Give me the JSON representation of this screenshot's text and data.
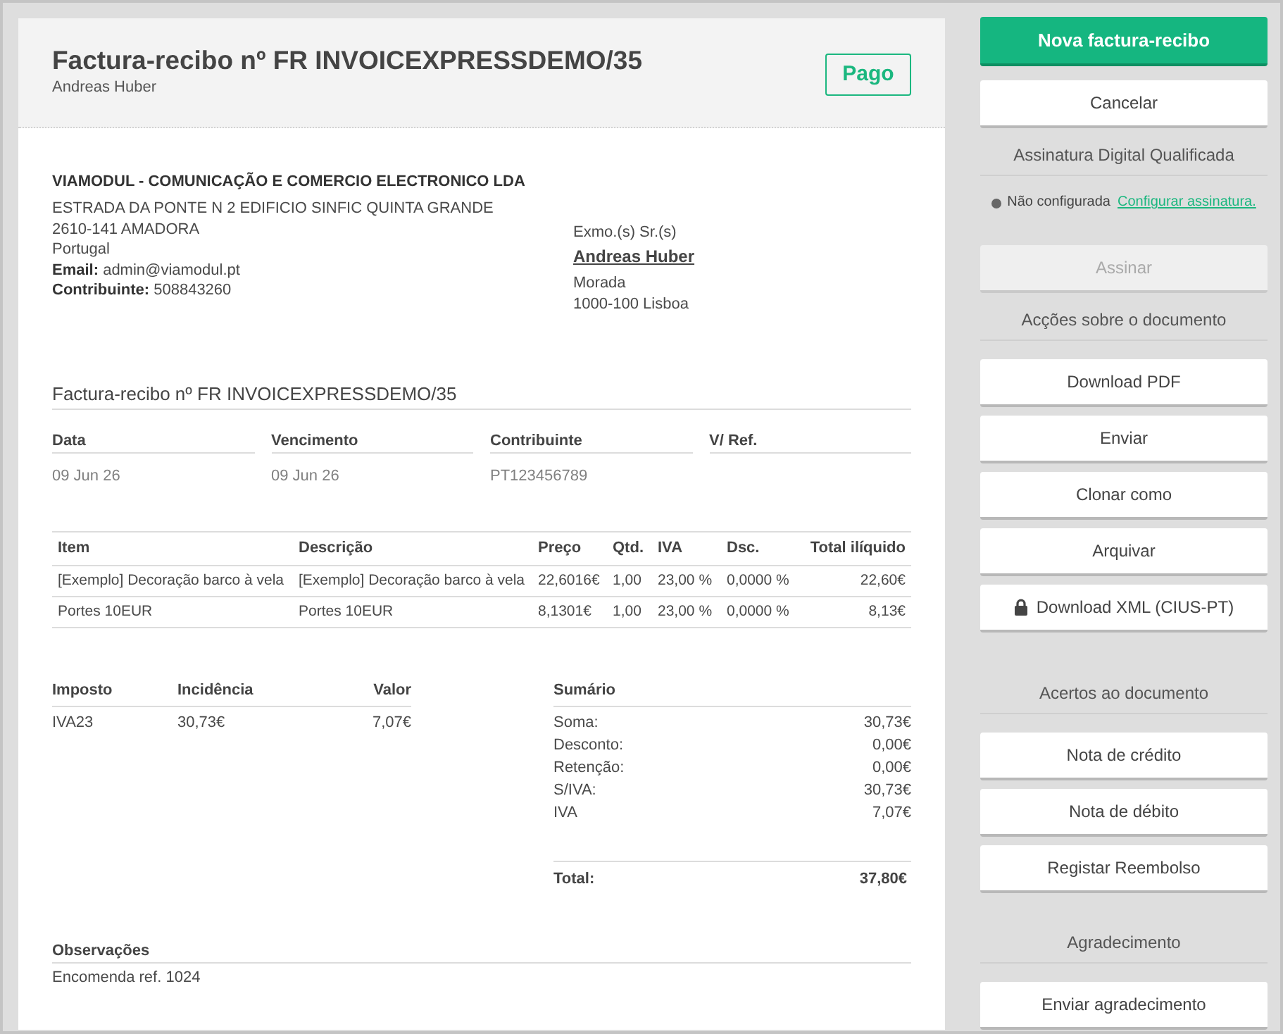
{
  "document": {
    "title": "Factura-recibo nº FR INVOICEXPRESSDEMO/35",
    "client": "Andreas Huber",
    "status": {
      "label": "Pago",
      "kind": "paid"
    }
  },
  "issuer": {
    "name": "VIAMODUL - COMUNICAÇÃO E COMERCIO ELECTRONICO LDA",
    "address_lines": [
      "ESTRADA DA PONTE N 2 EDIFICIO SINFIC QUINTA GRANDE",
      "2610-141 AMADORA",
      "Portugal"
    ],
    "details": [
      "**Email:** admin@viamodul.pt",
      "**Contribuinte:** 508843260"
    ]
  },
  "recipient": {
    "salutation": "Exmo.(s) Sr.(s)",
    "name": "Andreas Huber",
    "address_lines": [
      "Morada",
      "1000-100 Lisboa"
    ]
  },
  "section_title": "Factura-recibo nº FR INVOICEXPRESSDEMO/35",
  "meta": [
    {
      "label": "Data",
      "value": "09 Jun 26"
    },
    {
      "label": "Vencimento",
      "value": "09 Jun 26"
    },
    {
      "label": "Contribuinte",
      "value": "PT123456789"
    },
    {
      "label": "V/ Ref."
    }
  ],
  "items_table": {
    "columns": [
      "Item",
      "Descrição",
      "Preço",
      "Qtd.",
      "IVA",
      "Dsc.",
      "Total ilíquido"
    ],
    "rows": [
      [
        "[Exemplo] Decoração barco à vela",
        "[Exemplo] Decoração barco à vela",
        "22,6016€",
        "1,00",
        "23,00 %",
        "0,0000 %",
        "22,60€"
      ],
      [
        "Portes 10EUR",
        "Portes 10EUR",
        "8,1301€",
        "1,00",
        "23,00 %",
        "0,0000 %",
        "8,13€"
      ]
    ]
  },
  "tax_table": {
    "columns": [
      "Imposto",
      "Incidência",
      "Valor"
    ],
    "rows": [
      [
        "IVA23",
        "30,73€",
        "7,07€"
      ]
    ]
  },
  "summary": {
    "title": "Sumário",
    "rows": [
      {
        "label": "Soma:",
        "value": "30,73€"
      },
      {
        "label": "Desconto:",
        "value": "0,00€"
      },
      {
        "label": "Retenção:",
        "value": "0,00€"
      },
      {
        "label": "S/IVA:",
        "value": "30,73€"
      },
      {
        "label": "IVA",
        "value": "7,07€"
      }
    ],
    "total": {
      "label": "Total:",
      "value": "37,80€"
    }
  },
  "notes": {
    "title": "Observações",
    "text": "Encomenda ref. 1024"
  },
  "sidebar": {
    "actions": [
      {
        "kind": "primary_button",
        "label": "Nova factura-recibo",
        "disabled": false,
        "locked": false
      },
      {
        "kind": "button",
        "label": "Cancelar",
        "disabled": false,
        "locked": false
      }
    ],
    "sections": [
      {
        "title": "Assinatura Digital Qualificada",
        "items": [
          {
            "kind": "signature_status",
            "label": "Não configurada",
            "configured": false,
            "link": "Configurar assinatura."
          },
          {
            "kind": "button",
            "label": "Assinar",
            "disabled": true,
            "locked": false
          }
        ]
      },
      {
        "title": "Acções sobre o documento",
        "items": [
          {
            "kind": "button",
            "label": "Download PDF",
            "disabled": false,
            "locked": false
          },
          {
            "kind": "button",
            "label": "Enviar",
            "disabled": false,
            "locked": false
          },
          {
            "kind": "button",
            "label": "Clonar como",
            "disabled": false,
            "locked": false
          },
          {
            "kind": "button",
            "label": "Arquivar",
            "disabled": false,
            "locked": false
          },
          {
            "kind": "button",
            "label": "Download XML (CIUS-PT)",
            "disabled": false,
            "locked": true
          }
        ]
      },
      {
        "title": "Acertos ao documento",
        "items": [
          {
            "kind": "button",
            "label": "Nota de crédito",
            "disabled": false,
            "locked": false
          },
          {
            "kind": "button",
            "label": "Nota de débito",
            "disabled": false,
            "locked": false
          },
          {
            "kind": "button",
            "label": "Registar Reembolso",
            "disabled": false,
            "locked": false
          }
        ]
      },
      {
        "title": "Agradecimento",
        "items": [
          {
            "kind": "button",
            "label": "Enviar agradecimento",
            "disabled": false,
            "locked": false
          }
        ]
      }
    ]
  }
}
